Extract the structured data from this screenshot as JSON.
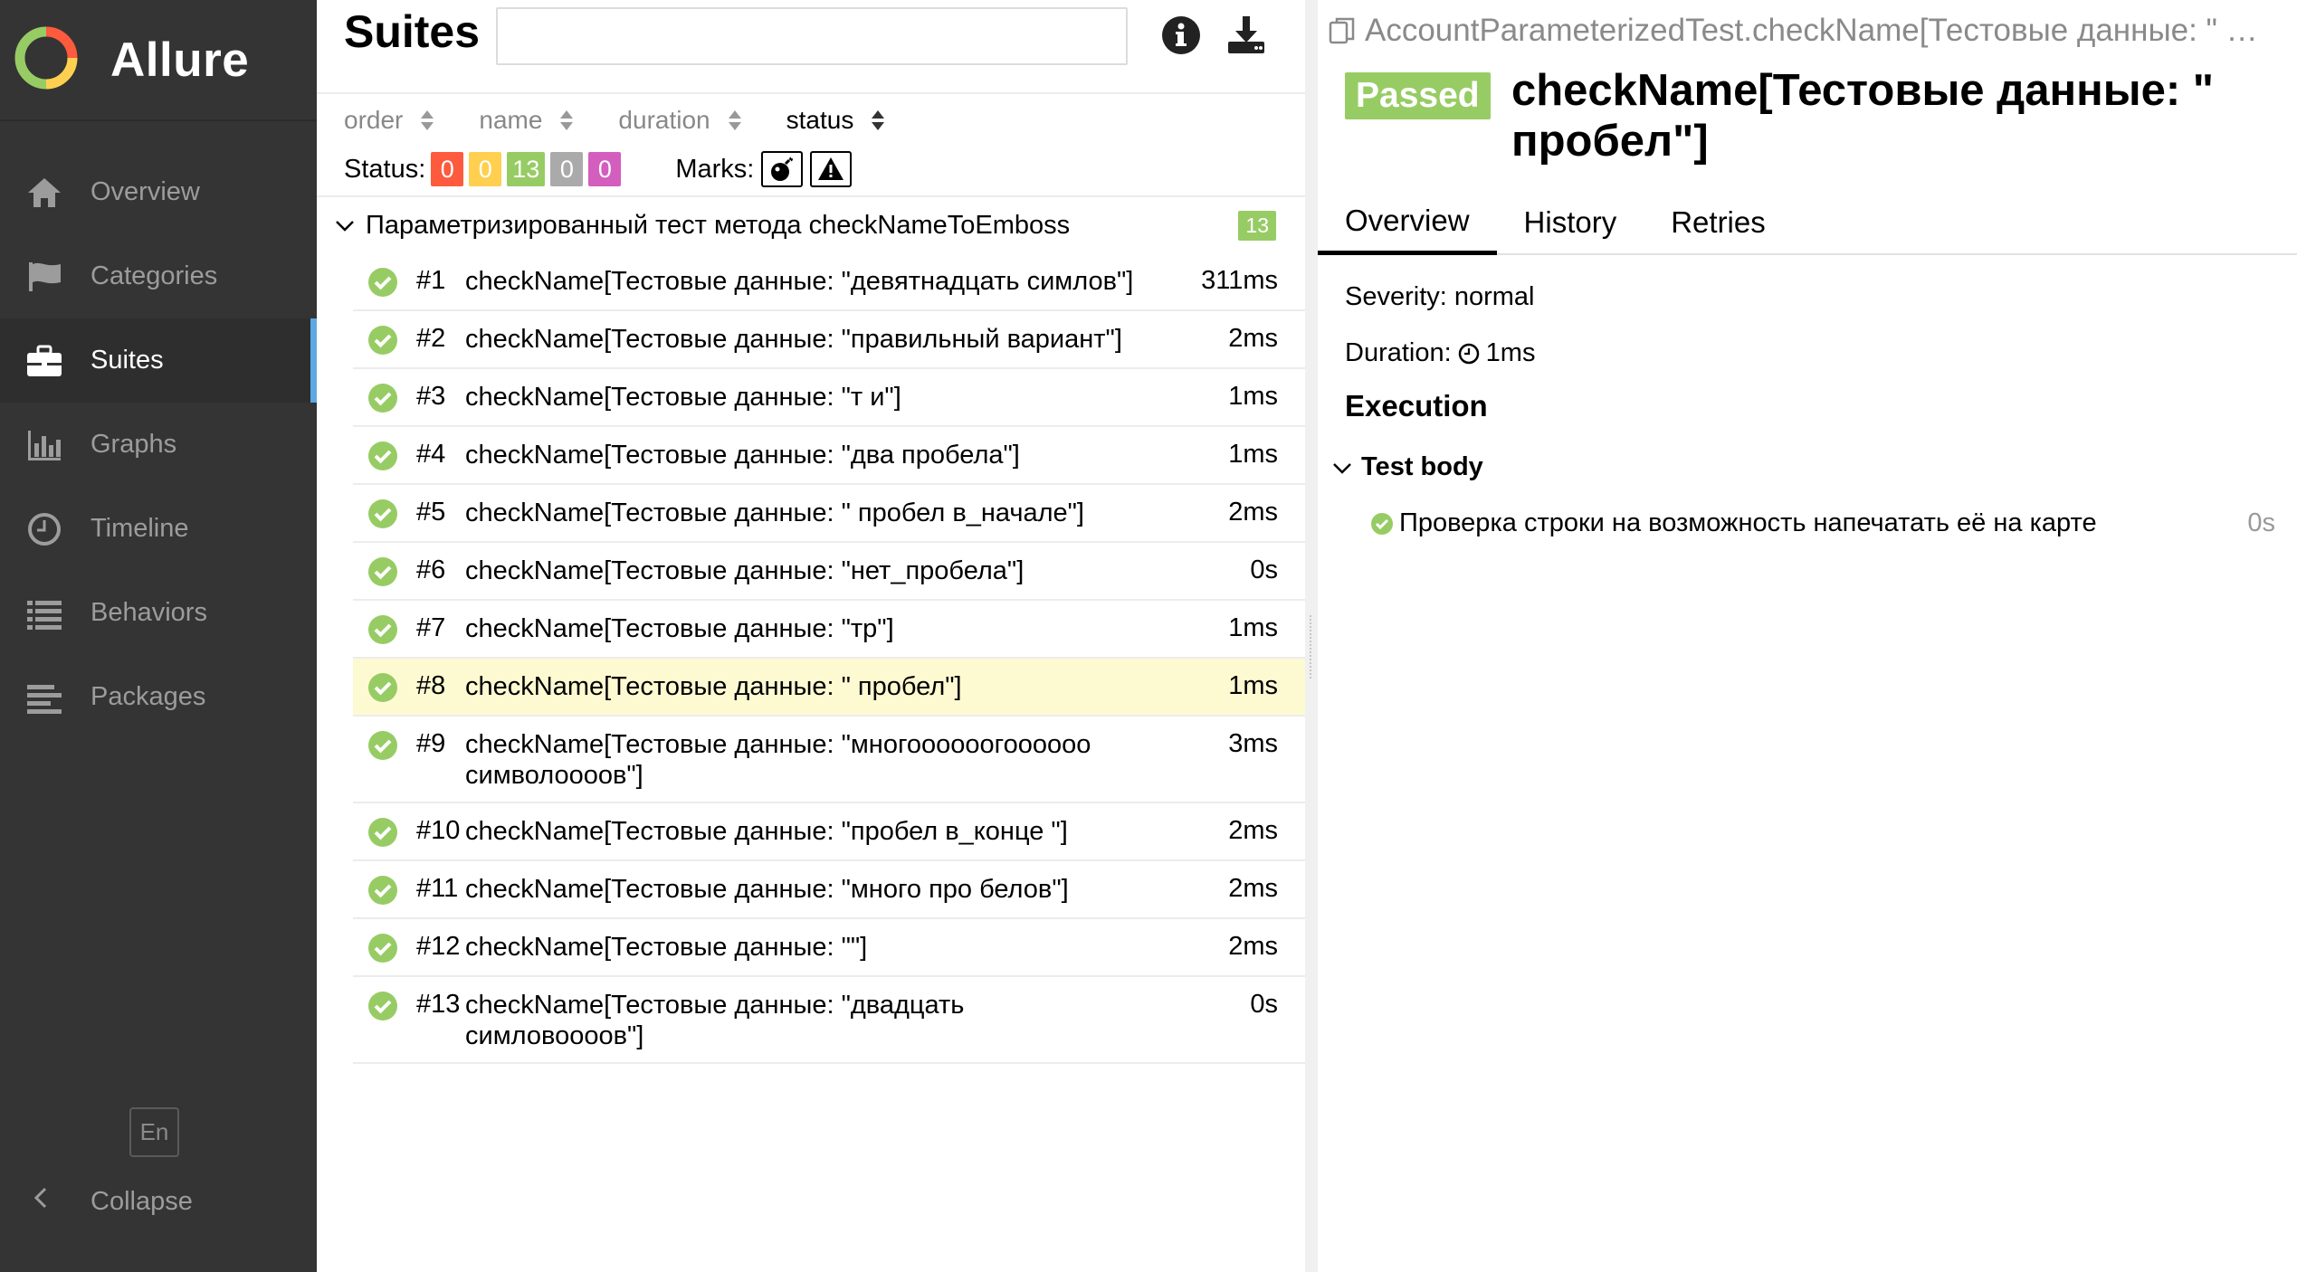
{
  "app": {
    "name": "Allure",
    "logo_colors": [
      "#97cc64",
      "#fd5a3e",
      "#ffd050",
      "#5ca7e6"
    ]
  },
  "sidebar": {
    "items": [
      {
        "label": "Overview",
        "icon": "home-icon",
        "active": false
      },
      {
        "label": "Categories",
        "icon": "flag-icon",
        "active": false
      },
      {
        "label": "Suites",
        "icon": "briefcase-icon",
        "active": true
      },
      {
        "label": "Graphs",
        "icon": "bar-chart-icon",
        "active": false
      },
      {
        "label": "Timeline",
        "icon": "clock-icon",
        "active": false
      },
      {
        "label": "Behaviors",
        "icon": "list-icon",
        "active": false
      },
      {
        "label": "Packages",
        "icon": "align-left-icon",
        "active": false
      }
    ],
    "language": "En",
    "collapse_label": "Collapse"
  },
  "suites": {
    "title": "Suites",
    "search_value": "",
    "info_icon": "info-icon",
    "download_icon": "download-icon",
    "sorters": [
      "order",
      "name",
      "duration",
      "status"
    ],
    "active_sorter": "status",
    "status_label": "Status:",
    "status_counts": {
      "failed": "0",
      "broken": "0",
      "passed": "13",
      "skipped": "0",
      "unknown": "0"
    },
    "marks_label": "Marks:",
    "group": {
      "name": "Параметризированный тест метода checkNameToEmboss",
      "count": "13"
    },
    "rows": [
      {
        "num": "#1",
        "name": "checkName[Тестовые данные: \"девятнадцать симлов\"]",
        "duration": "311ms"
      },
      {
        "num": "#2",
        "name": "checkName[Тестовые данные: \"правильный вариант\"]",
        "duration": "2ms"
      },
      {
        "num": "#3",
        "name": "checkName[Тестовые данные: \"т и\"]",
        "duration": "1ms"
      },
      {
        "num": "#4",
        "name": "checkName[Тестовые данные: \"два пробела\"]",
        "duration": "1ms"
      },
      {
        "num": "#5",
        "name": "checkName[Тестовые данные: \" пробел в_начале\"]",
        "duration": "2ms"
      },
      {
        "num": "#6",
        "name": "checkName[Тестовые данные: \"нет_пробела\"]",
        "duration": "0s"
      },
      {
        "num": "#7",
        "name": "checkName[Тестовые данные: \"тр\"]",
        "duration": "1ms"
      },
      {
        "num": "#8",
        "name": "checkName[Тестовые данные: \" пробел\"]",
        "duration": "1ms"
      },
      {
        "num": "#9",
        "name": "checkName[Тестовые данные: \"многоооооогоооооо символоооов\"]",
        "duration": "3ms"
      },
      {
        "num": "#10",
        "name": "checkName[Тестовые данные: \"пробел в_конце \"]",
        "duration": "2ms"
      },
      {
        "num": "#11",
        "name": "checkName[Тестовые данные: \"много про белов\"]",
        "duration": "2ms"
      },
      {
        "num": "#12",
        "name": "checkName[Тестовые данные: \"\"]",
        "duration": "2ms"
      },
      {
        "num": "#13",
        "name": "checkName[Тестовые данные: \"двадцать симловоооов\"]",
        "duration": "0s"
      }
    ],
    "selected_row": "#8"
  },
  "detail": {
    "breadcrumb": "AccountParameterizedTest.checkName[Тестовые данные: \" …",
    "status": "Passed",
    "title": "checkName[Тестовые данные: \" пробел\"]",
    "tabs": [
      "Overview",
      "History",
      "Retries"
    ],
    "active_tab": "Overview",
    "severity_label": "Severity:",
    "severity": "normal",
    "duration_label": "Duration:",
    "duration": "1ms",
    "execution_title": "Execution",
    "test_body_label": "Test body",
    "steps": [
      {
        "name": "Проверка строки на возможность напечатать её на карте",
        "duration": "0s",
        "status": "passed"
      }
    ]
  }
}
